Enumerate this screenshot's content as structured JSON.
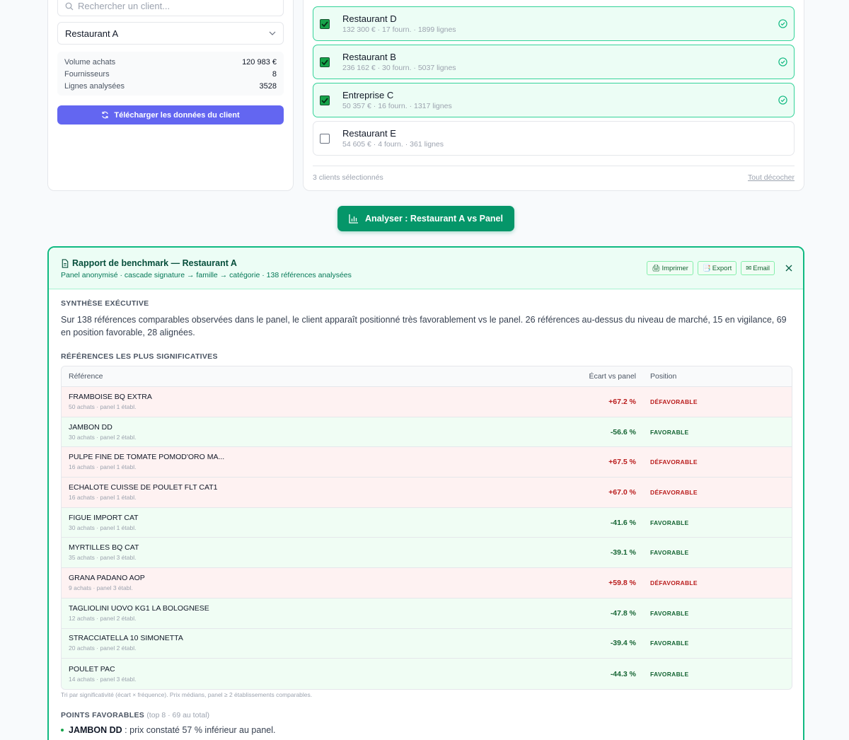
{
  "client_panel": {
    "search_placeholder": "Rechercher un client...",
    "selected_client": "Restaurant A",
    "stats": [
      {
        "label": "Volume achats",
        "value": "120 983 €"
      },
      {
        "label": "Fournisseurs",
        "value": "8"
      },
      {
        "label": "Lignes analysées",
        "value": "3528"
      }
    ],
    "download_label": "Télécharger les données du client"
  },
  "panel_selection": {
    "clients": [
      {
        "name": "Restaurant D",
        "meta": "132 300 € · 17 fourn. · 1899 lignes",
        "checked": true
      },
      {
        "name": "Restaurant B",
        "meta": "236 162 € · 30 fourn. · 5037 lignes",
        "checked": true
      },
      {
        "name": "Entreprise C",
        "meta": "50 357 € · 16 fourn. · 1317 lignes",
        "checked": true
      },
      {
        "name": "Restaurant E",
        "meta": "54 605 € · 4 fourn. · 361 lignes",
        "checked": false
      }
    ],
    "selected_count": "3 clients sélectionnés",
    "uncheck_all": "Tout décocher"
  },
  "analyse_button": "Analyser : Restaurant A vs Panel",
  "report": {
    "title": "Rapport de benchmark — Restaurant A",
    "subtitle": "Panel anonymisé · cascade signature → famille → catégorie · 138 références analysées",
    "actions": {
      "print": "Imprimer",
      "export": "Export",
      "email": "Email"
    },
    "summary_title": "SYNTHÈSE EXÉCUTIVE",
    "summary_text": "Sur 138 références comparables observées dans le panel, le client apparaît positionné très favorablement vs le panel. 26 références au-dessus du niveau de marché, 15 en vigilance, 69 en position favorable, 28 alignées.",
    "refs_title": "RÉFÉRENCES LES PLUS SIGNIFICATIVES",
    "table_headers": {
      "ref": "Référence",
      "gap": "Écart vs panel",
      "pos": "Position"
    },
    "rows": [
      {
        "name": "FRAMBOISE BQ EXTRA",
        "meta": "50 achats · panel 1 établ.",
        "gap": "+67.2 %",
        "position": "DÉFAVORABLE",
        "kind": "bad"
      },
      {
        "name": "JAMBON DD",
        "meta": "30 achats · panel 2 établ.",
        "gap": "-56.6 %",
        "position": "FAVORABLE",
        "kind": "good"
      },
      {
        "name": "PULPE FINE DE TOMATE POMOD'ORO MA...",
        "meta": "16 achats · panel 1 établ.",
        "gap": "+67.5 %",
        "position": "DÉFAVORABLE",
        "kind": "bad"
      },
      {
        "name": "ECHALOTE CUISSE DE POULET FLT CAT1",
        "meta": "16 achats · panel 1 établ.",
        "gap": "+67.0 %",
        "position": "DÉFAVORABLE",
        "kind": "bad"
      },
      {
        "name": "FIGUE IMPORT CAT",
        "meta": "30 achats · panel 1 établ.",
        "gap": "-41.6 %",
        "position": "FAVORABLE",
        "kind": "good"
      },
      {
        "name": "MYRTILLES BQ CAT",
        "meta": "35 achats · panel 3 établ.",
        "gap": "-39.1 %",
        "position": "FAVORABLE",
        "kind": "good"
      },
      {
        "name": "GRANA PADANO AOP",
        "meta": "9 achats · panel 3 établ.",
        "gap": "+59.8 %",
        "position": "DÉFAVORABLE",
        "kind": "bad"
      },
      {
        "name": "TAGLIOLINI UOVO KG1 LA BOLOGNESE",
        "meta": "12 achats · panel 2 établ.",
        "gap": "-47.8 %",
        "position": "FAVORABLE",
        "kind": "good"
      },
      {
        "name": "STRACCIATELLA 10 SIMONETTA",
        "meta": "20 achats · panel 2 établ.",
        "gap": "-39.4 %",
        "position": "FAVORABLE",
        "kind": "good"
      },
      {
        "name": "POULET PAC",
        "meta": "14 achats · panel 3 établ.",
        "gap": "-44.3 %",
        "position": "FAVORABLE",
        "kind": "good"
      }
    ],
    "table_note": "Tri par significativité (écart × fréquence). Prix médians, panel ≥ 2 établissements comparables.",
    "favorable_title": "POINTS FAVORABLES",
    "favorable_count": "(top 8 · 69 au total)",
    "favorable_first": {
      "name": "JAMBON DD",
      "text": " : prix constaté 57 % inférieur au panel."
    }
  }
}
